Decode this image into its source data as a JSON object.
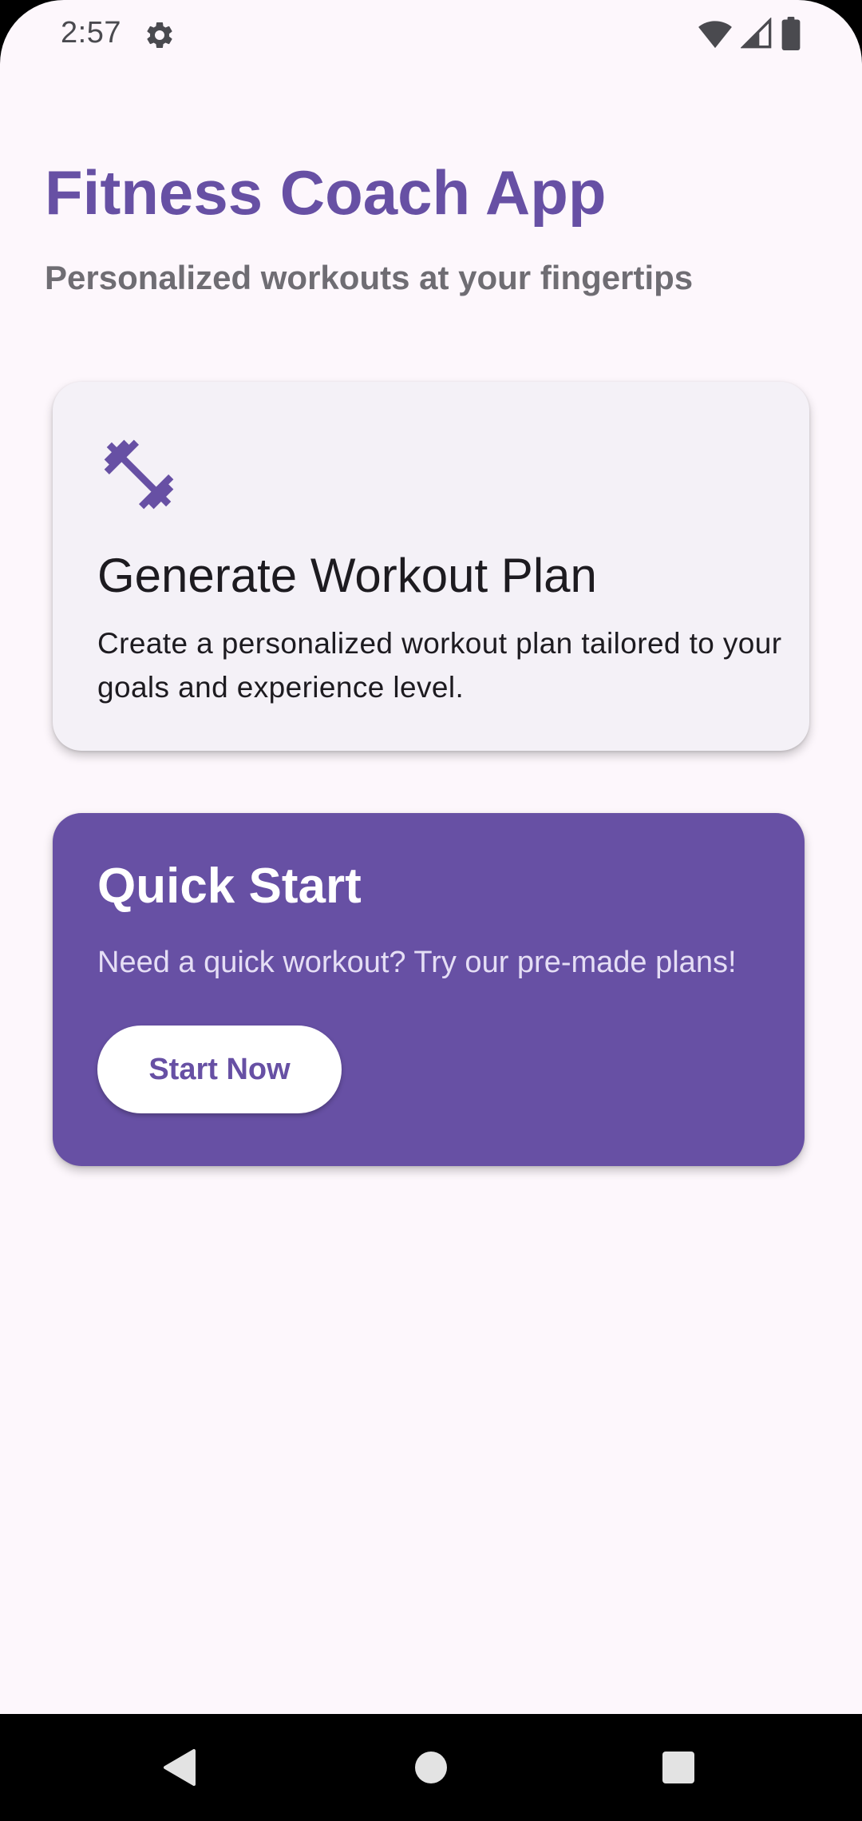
{
  "status_bar": {
    "time": "2:57",
    "icons": [
      "gear-icon",
      "wifi-icon",
      "signal-icon",
      "battery-icon"
    ]
  },
  "header": {
    "title": "Fitness Coach App",
    "subtitle": "Personalized workouts at your fingertips"
  },
  "generate_card": {
    "icon": "dumbbell-icon",
    "title": "Generate Workout Plan",
    "description": "Create a personalized workout plan tailored to your goals and experience level."
  },
  "quick_start_card": {
    "title": "Quick Start",
    "description": "Need a quick workout? Try our pre-made plans!",
    "button_label": "Start Now"
  },
  "nav_bar": {
    "items": [
      "back-icon",
      "home-icon",
      "recents-icon"
    ]
  },
  "colors": {
    "primary": "#6750A4",
    "background": "#FDF7FC",
    "card_surface": "#F4F1F7",
    "subtitle_gray": "#6F6D73",
    "text_dark": "#1D1B20"
  }
}
